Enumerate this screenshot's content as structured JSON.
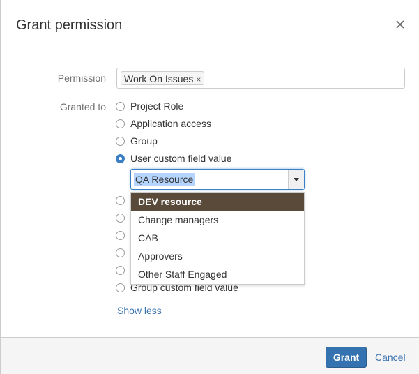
{
  "dialog": {
    "title": "Grant permission",
    "close_icon": "close-icon"
  },
  "form": {
    "permission_label": "Permission",
    "permission_tag": "Work On Issues",
    "permission_tag_remove": "×",
    "granted_to_label": "Granted to",
    "options": [
      {
        "label": "Project Role",
        "checked": false
      },
      {
        "label": "Application access",
        "checked": false
      },
      {
        "label": "Group",
        "checked": false
      },
      {
        "label": "User custom field value",
        "checked": true
      },
      {
        "label": "",
        "checked": false
      },
      {
        "label": "",
        "checked": false
      },
      {
        "label": "",
        "checked": false
      },
      {
        "label": "",
        "checked": false
      },
      {
        "label": "",
        "checked": false
      },
      {
        "label": "Group custom field value",
        "checked": false
      }
    ],
    "custom_field_select": {
      "value": "QA Resource",
      "dropdown_items": [
        {
          "label": "DEV resource",
          "highlighted": true
        },
        {
          "label": "Change managers",
          "highlighted": false
        },
        {
          "label": "CAB",
          "highlighted": false
        },
        {
          "label": "Approvers",
          "highlighted": false
        },
        {
          "label": "Other Staff Engaged",
          "highlighted": false
        }
      ]
    },
    "show_less": "Show less"
  },
  "footer": {
    "grant_label": "Grant",
    "cancel_label": "Cancel"
  },
  "colors": {
    "primary": "#3572b0",
    "link": "#3b73af",
    "highlight": "#594a3a"
  }
}
